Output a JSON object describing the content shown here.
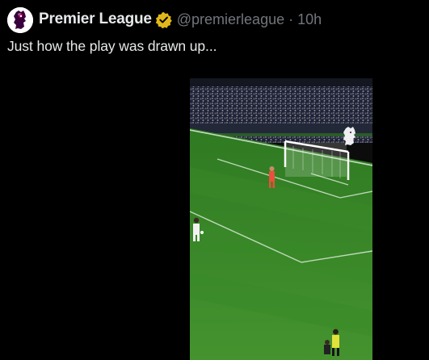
{
  "author": {
    "display_name": "Premier League",
    "handle": "@premierleague",
    "separator": "·",
    "timestamp": "10h",
    "avatar_icon": "premier-league-lion-icon",
    "verified_icon": "verified-badge-icon",
    "verified_color": "#e2b719"
  },
  "tweet": {
    "text": "Just how the play was drawn up..."
  },
  "media": {
    "type": "video",
    "watermark_icon": "premier-league-lion-icon"
  },
  "colors": {
    "background": "#000000",
    "primary_text": "#e7e9ea",
    "secondary_text": "#71767b",
    "pitch": "#3d8a2a"
  }
}
